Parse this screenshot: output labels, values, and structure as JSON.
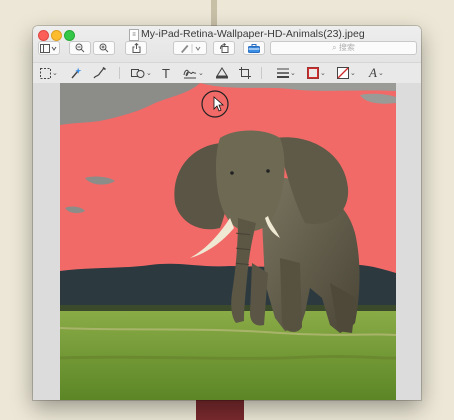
{
  "window": {
    "title": "My-iPad-Retina-Wallpaper-HD-Animals(23).jpeg"
  },
  "toolbar": {
    "search_placeholder": "搜索",
    "buttons": [
      "sidebar-icon",
      "zoom-out-icon",
      "zoom-in-icon",
      "share-icon",
      "pen-icon",
      "rotate-icon",
      "toolbox-icon"
    ]
  },
  "markup_toolbar": {
    "tools": [
      "rect-select-icon",
      "instant-alpha-icon",
      "sketch-icon",
      "shapes-icon",
      "text-icon",
      "signature-icon",
      "adjust-color-icon",
      "crop-icon",
      "line-style-icon",
      "border-color-icon",
      "fill-color-icon",
      "text-style-icon"
    ],
    "text_tool_label": "T",
    "text_style_label": "A"
  },
  "image": {
    "subject": "elephant",
    "colors": {
      "sky": "#f26a68",
      "grass": "#7ea63c",
      "hills": "#2c3a40"
    }
  },
  "colors": {
    "desk": "#ece7d6",
    "accent_red": "#d12a2a"
  }
}
